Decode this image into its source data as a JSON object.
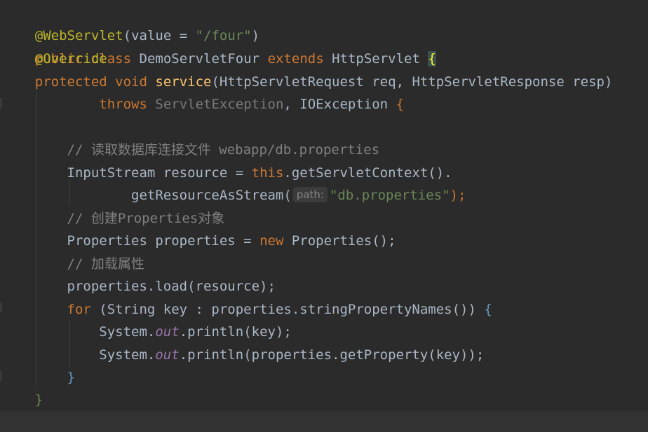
{
  "editor": {
    "lines": {
      "l1": {
        "annotation": "@WebServlet",
        "open": "(",
        "value_kw": "value = ",
        "value_str": "\"/four\"",
        "close": ")"
      },
      "l2": {
        "public": "public",
        "class": "class",
        "name": "DemoServletFour",
        "extends": "extends",
        "parent": "HttpServlet",
        "brace": "{"
      },
      "l3": {
        "override": "@Override"
      },
      "l4": {
        "protected": "protected",
        "void": "void",
        "method": "service",
        "params": "(HttpServletRequest req, HttpServletResponse resp)"
      },
      "l5": {
        "throws": "throws",
        "ex1": "ServletException",
        "sep": ", IOException ",
        "brace": "{"
      },
      "l7": {
        "comment": "// 读取数据库连接文件 webapp/db.properties"
      },
      "l8": {
        "decl": "InputStream resource = ",
        "this": "this",
        "call": ".getServletContext()."
      },
      "l9": {
        "method": "getResourceAsStream(",
        "hint": "path:",
        "str": "\"db.properties\"",
        "end": ");"
      },
      "l10": {
        "comment": "// 创建Properties对象"
      },
      "l11": {
        "decl": "Properties properties = ",
        "new": "new",
        "ctor": " Properties();"
      },
      "l12": {
        "comment": "// 加载属性"
      },
      "l13": {
        "code": "properties.load(resource);"
      },
      "l14": {
        "for": "for",
        "head": " (String key : properties.stringPropertyNames()) ",
        "brace": "{"
      },
      "l15": {
        "pre": "System.",
        "out": "out",
        "post": ".println(key);"
      },
      "l16": {
        "pre": "System.",
        "out": "out",
        "post": ".println(properties.getProperty(key));"
      },
      "l17": {
        "brace": "}"
      },
      "l18": {
        "brace": "}"
      },
      "l19": {
        "brace": "}"
      }
    }
  },
  "colors": {
    "background": "#2b2b2b",
    "keyword": "#cc7832",
    "annotation": "#bbb529",
    "string": "#6a8759",
    "comment": "#808080",
    "method": "#ffc66d",
    "text": "#a9b7c6"
  }
}
